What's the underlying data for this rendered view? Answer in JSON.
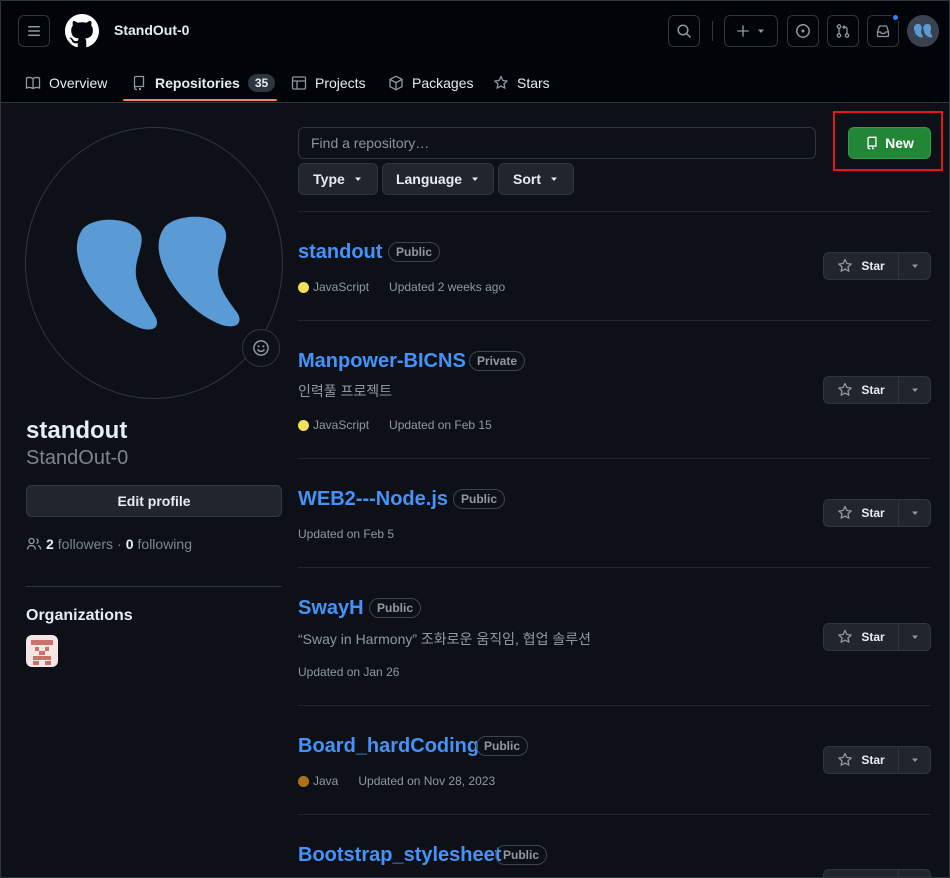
{
  "header": {
    "context_title": "StandOut-0",
    "tabs": [
      {
        "label": "Overview",
        "icon": "book-icon"
      },
      {
        "label": "Repositories",
        "icon": "repo-icon",
        "count": "35",
        "active": true
      },
      {
        "label": "Projects",
        "icon": "table-icon"
      },
      {
        "label": "Packages",
        "icon": "package-icon"
      },
      {
        "label": "Stars",
        "icon": "star-icon"
      }
    ]
  },
  "profile": {
    "display_name": "standout",
    "login": "StandOut-0",
    "edit_label": "Edit profile",
    "followers_count": "2",
    "followers_label": "followers",
    "separator": "·",
    "following_count": "0",
    "following_label": "following",
    "organizations_title": "Organizations"
  },
  "filters": {
    "search_placeholder": "Find a repository…",
    "type_label": "Type",
    "language_label": "Language",
    "sort_label": "Sort",
    "new_label": "New"
  },
  "repos": [
    {
      "name": "standout",
      "visibility": "Public",
      "description": "",
      "language": "JavaScript",
      "lang_color": "#f1e05a",
      "updated": "Updated 2 weeks ago"
    },
    {
      "name": "Manpower-BICNS",
      "visibility": "Private",
      "description": "인력풀 프로젝트",
      "language": "JavaScript",
      "lang_color": "#f1e05a",
      "updated": "Updated on Feb 15"
    },
    {
      "name": "WEB2---Node.js",
      "visibility": "Public",
      "description": "",
      "language": "",
      "lang_color": "",
      "updated": "Updated on Feb 5"
    },
    {
      "name": "SwayH",
      "visibility": "Public",
      "description": "“Sway in Harmony” 조화로운 움직임, 협업 솔루션",
      "language": "",
      "lang_color": "",
      "updated": "Updated on Jan 26"
    },
    {
      "name": "Board_hardCoding",
      "visibility": "Public",
      "description": "",
      "language": "Java",
      "lang_color": "#b07219",
      "updated": "Updated on Nov 28, 2023"
    },
    {
      "name": "Bootstrap_stylesheet",
      "visibility": "Public",
      "description": "",
      "language": "",
      "lang_color": "",
      "updated": ""
    }
  ],
  "star_label": "Star",
  "colors": {
    "accent_link": "#4493f8",
    "primary_button": "#238636",
    "highlight_box": "#e5151c",
    "tab_underline": "#f78166"
  }
}
